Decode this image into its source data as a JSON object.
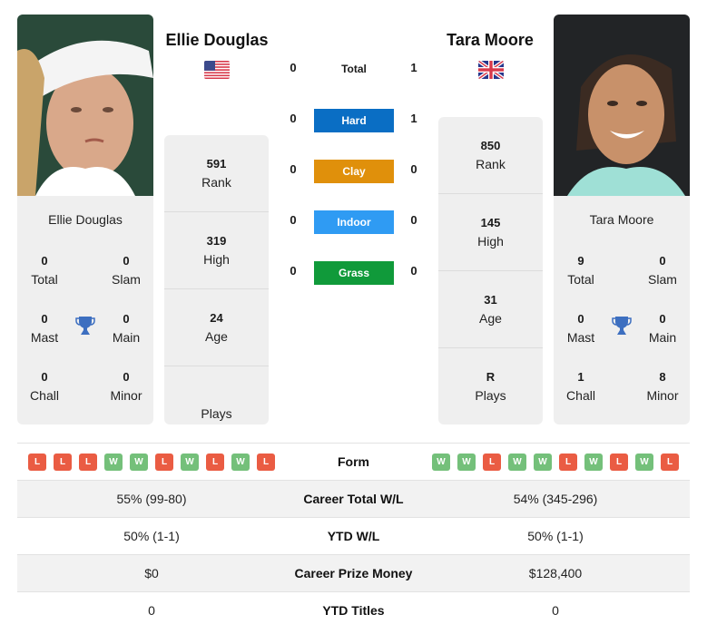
{
  "players": {
    "left": {
      "name": "Ellie Douglas",
      "flag": "us-flag",
      "titles": {
        "total": {
          "value": "0",
          "label": "Total"
        },
        "slam": {
          "value": "0",
          "label": "Slam"
        },
        "mast": {
          "value": "0",
          "label": "Mast"
        },
        "main": {
          "value": "0",
          "label": "Main"
        },
        "chall": {
          "value": "0",
          "label": "Chall"
        },
        "minor": {
          "value": "0",
          "label": "Minor"
        }
      },
      "info": {
        "rank": {
          "value": "591",
          "label": "Rank"
        },
        "high": {
          "value": "319",
          "label": "High"
        },
        "age": {
          "value": "24",
          "label": "Age"
        },
        "plays": {
          "value": "",
          "label": "Plays"
        }
      },
      "form": [
        "L",
        "L",
        "L",
        "W",
        "W",
        "L",
        "W",
        "L",
        "W",
        "L"
      ]
    },
    "right": {
      "name": "Tara Moore",
      "flag": "uk-flag",
      "titles": {
        "total": {
          "value": "9",
          "label": "Total"
        },
        "slam": {
          "value": "0",
          "label": "Slam"
        },
        "mast": {
          "value": "0",
          "label": "Mast"
        },
        "main": {
          "value": "0",
          "label": "Main"
        },
        "chall": {
          "value": "1",
          "label": "Chall"
        },
        "minor": {
          "value": "8",
          "label": "Minor"
        }
      },
      "info": {
        "rank": {
          "value": "850",
          "label": "Rank"
        },
        "high": {
          "value": "145",
          "label": "High"
        },
        "age": {
          "value": "31",
          "label": "Age"
        },
        "plays": {
          "value": "R",
          "label": "Plays"
        }
      },
      "form": [
        "W",
        "W",
        "L",
        "W",
        "W",
        "L",
        "W",
        "L",
        "W",
        "L"
      ]
    }
  },
  "h2h": {
    "total": {
      "label": "Total",
      "left": "0",
      "right": "1"
    },
    "surfaces": [
      {
        "label": "Hard",
        "left": "0",
        "right": "1",
        "color": "#0a6ec4"
      },
      {
        "label": "Clay",
        "left": "0",
        "right": "0",
        "color": "#e0900b"
      },
      {
        "label": "Indoor",
        "left": "0",
        "right": "0",
        "color": "#2f9bf3"
      },
      {
        "label": "Grass",
        "left": "0",
        "right": "0",
        "color": "#109a3a"
      }
    ]
  },
  "table": {
    "form_label": "Form",
    "rows": [
      {
        "label": "Career Total W/L",
        "left": "55% (99-80)",
        "right": "54% (345-296)"
      },
      {
        "label": "YTD W/L",
        "left": "50% (1-1)",
        "right": "50% (1-1)"
      },
      {
        "label": "Career Prize Money",
        "left": "$0",
        "right": "$128,400"
      },
      {
        "label": "YTD Titles",
        "left": "0",
        "right": "0"
      }
    ]
  },
  "colors": {
    "win": "#74c07a",
    "loss": "#ea5c43",
    "trophy": "#3d6fc0",
    "card_bg": "#efefef"
  }
}
